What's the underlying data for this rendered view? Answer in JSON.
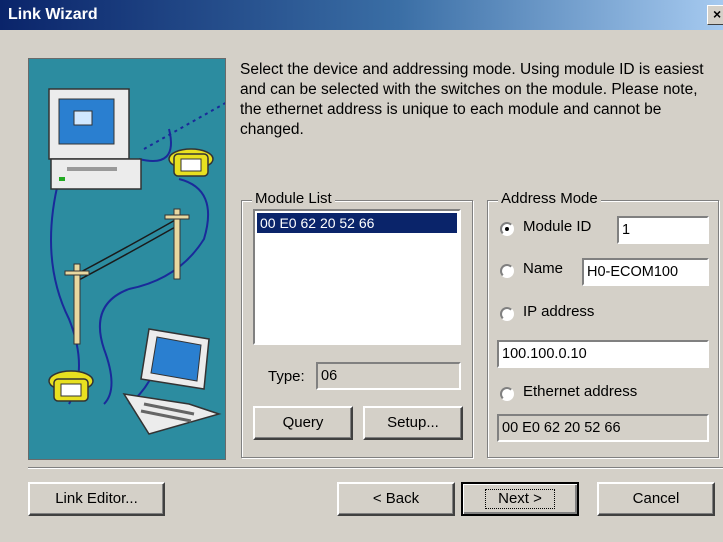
{
  "window": {
    "title": "Link Wizard",
    "close_glyph": "×"
  },
  "intro_text": "Select the device and addressing mode. Using module ID is easiest and can be selected with the switches on the module. Please note, the ethernet address is unique to each module and cannot be changed.",
  "module_list": {
    "label": "Module List",
    "items": [
      "00 E0 62 20 52 66"
    ],
    "type_label": "Type:",
    "type_value": "06",
    "query_button": "Query",
    "setup_button": "Setup..."
  },
  "address_mode": {
    "label": "Address Mode",
    "selected": "Module ID",
    "module_id_label": "Module ID",
    "module_id_value": "1",
    "name_label": "Name",
    "name_value": "H0-ECOM100",
    "ip_label": "IP address",
    "ip_value": "100.100.0.10",
    "ethernet_label": "Ethernet address",
    "ethernet_value": "00 E0 62 20 52 66"
  },
  "buttons": {
    "link_editor": "Link Editor...",
    "back": "< Back",
    "next": "Next >",
    "cancel": "Cancel"
  },
  "colors": {
    "title_bar": "#0a246a",
    "illustration_bg": "#2c8ca0",
    "selection": "#0a246a"
  }
}
